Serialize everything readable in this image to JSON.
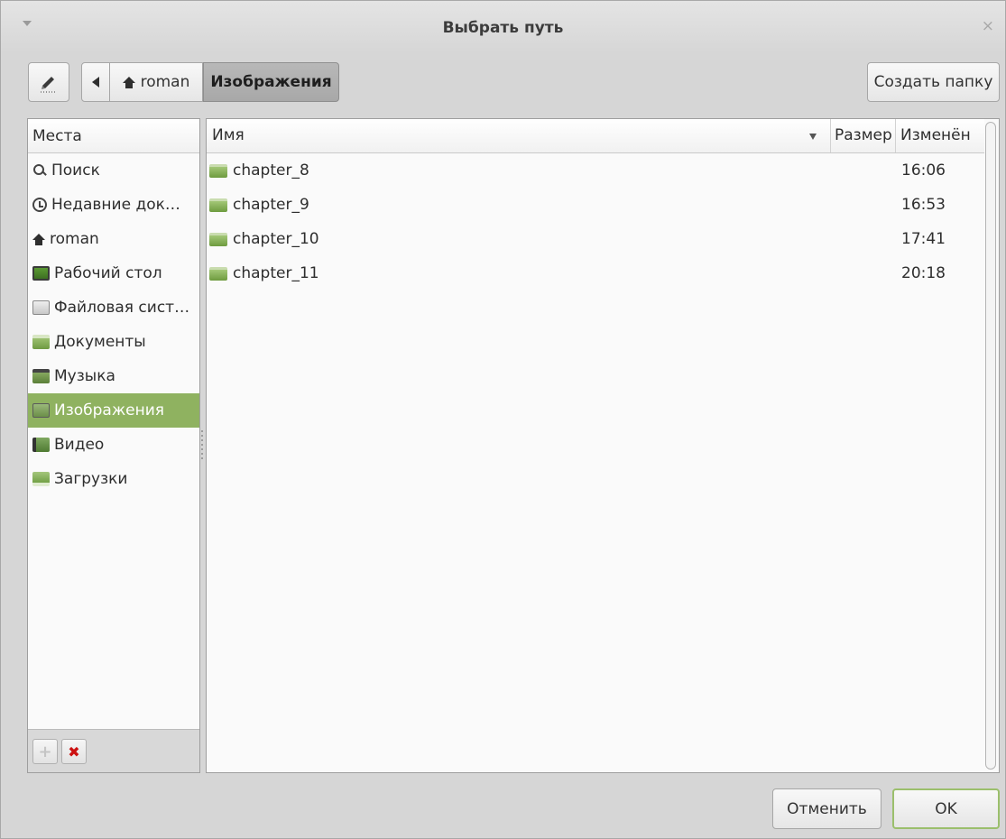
{
  "window": {
    "title": "Выбрать путь",
    "close_glyph": "×",
    "menu_icon": "chevron-down-icon"
  },
  "toolbar": {
    "edit_icon": "pencil-icon",
    "back_icon": "back-arrow-icon",
    "breadcrumb": [
      {
        "label": "roman",
        "icon": "home-icon"
      },
      {
        "label": "Изображения",
        "current": true
      }
    ],
    "new_folder_label": "Создать папку"
  },
  "places": {
    "header": "Места",
    "items": [
      {
        "label": "Поиск",
        "icon": "search-icon"
      },
      {
        "label": "Недавние док…",
        "icon": "recent-icon"
      },
      {
        "label": "roman",
        "icon": "home-icon"
      },
      {
        "label": "Рабочий стол",
        "icon": "desktop-icon"
      },
      {
        "label": "Файловая сист…",
        "icon": "drive-icon"
      },
      {
        "label": "Документы",
        "icon": "documents-folder-icon"
      },
      {
        "label": "Музыка",
        "icon": "music-folder-icon"
      },
      {
        "label": "Изображения",
        "icon": "pictures-folder-icon",
        "selected": true
      },
      {
        "label": "Видео",
        "icon": "video-folder-icon"
      },
      {
        "label": "Загрузки",
        "icon": "downloads-folder-icon"
      }
    ],
    "add_glyph": "+",
    "remove_glyph": "✖"
  },
  "files": {
    "columns": {
      "name": "Имя",
      "size": "Размер",
      "modified": "Изменён"
    },
    "rows": [
      {
        "name": "chapter_8",
        "modified": "16:06"
      },
      {
        "name": "chapter_9",
        "modified": "16:53"
      },
      {
        "name": "chapter_10",
        "modified": "17:41"
      },
      {
        "name": "chapter_11",
        "modified": "20:18"
      }
    ]
  },
  "actions": {
    "cancel_label": "Отменить",
    "ok_label": "OK"
  },
  "colors": {
    "selection": "#8fb260",
    "folder": "#7fa84e",
    "remove": "#cc1111"
  }
}
